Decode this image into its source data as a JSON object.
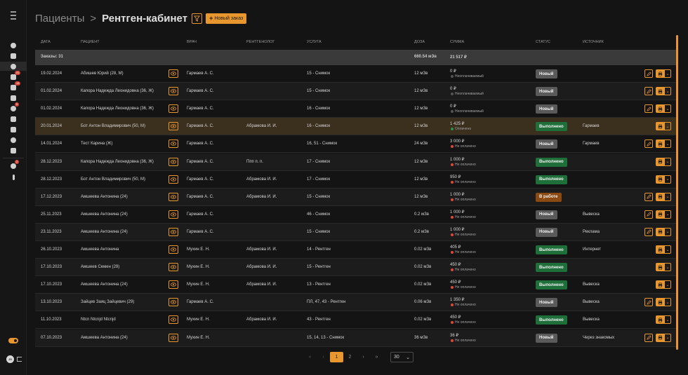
{
  "breadcrumb": {
    "root": "Пациенты",
    "separator": ">",
    "current": "Рентген-кабинет"
  },
  "toolbar": {
    "new_order_label": "Новый заказ"
  },
  "columns": {
    "date": "ДАТА",
    "patient": "ПАЦИЕНТ",
    "doctor": "ВРАЧ",
    "radiologist": "РЕНТГЕНОЛОГ",
    "service": "УСЛУГА",
    "dose": "ДОЗА",
    "sum": "СУММА",
    "status": "СТАТУС",
    "source": "ИСТОЧНИК"
  },
  "summary": {
    "orders": "Заказы: 31",
    "dose_total": "660.54 мЗв",
    "sum_total": "21 517 ₽"
  },
  "rows": [
    {
      "date": "19.02.2024",
      "patient": "Абишев Юрий (28, М)",
      "doctor": "Гармаев А. С.",
      "radiologist": "",
      "service": "15 - Снимок",
      "dose": "12 мЗв",
      "sum": "0 ₽",
      "pay": "Неоплачиваемый",
      "pay_state": "gray",
      "status": "Новый",
      "status_type": "new",
      "source": "",
      "editable": true,
      "highlight": false
    },
    {
      "date": "01.02.2024",
      "patient": "Капора Надежда Леонидовна (36, Ж)",
      "doctor": "Гармаев А. С.",
      "radiologist": "",
      "service": "15 - Снимок",
      "dose": "12 мЗв",
      "sum": "0 ₽",
      "pay": "Неоплачиваемый",
      "pay_state": "gray",
      "status": "Новый",
      "status_type": "new",
      "source": "",
      "editable": true,
      "highlight": false
    },
    {
      "date": "01.02.2024",
      "patient": "Капора Надежда Леонидовна (36, Ж)",
      "doctor": "Гармаев А. С.",
      "radiologist": "",
      "service": "16 - Снимок",
      "dose": "12 мЗв",
      "sum": "0 ₽",
      "pay": "Неоплачиваемый",
      "pay_state": "gray",
      "status": "Новый",
      "status_type": "new",
      "source": "",
      "editable": true,
      "highlight": false
    },
    {
      "date": "20.01.2024",
      "patient": "Бот Антон Владимирович (50, М)",
      "doctor": "Гармаев А. С.",
      "radiologist": "Абрамова И. И.",
      "service": "16 - Снимок",
      "dose": "12 мЗв",
      "sum": "1 425 ₽",
      "pay": "Оплачено",
      "pay_state": "green",
      "status": "Выполнено",
      "status_type": "done",
      "source": "Гармаев",
      "editable": false,
      "highlight": true
    },
    {
      "date": "14.01.2024",
      "patient": "Тест Карина (Ж)",
      "doctor": "Гармаев А. С.",
      "radiologist": "",
      "service": "16, 51 - Снимок",
      "dose": "24 мЗв",
      "sum": "3 000 ₽",
      "pay": "Не оплачено",
      "pay_state": "red",
      "status": "Новый",
      "status_type": "new",
      "source": "Гармаев",
      "editable": true,
      "highlight": false
    },
    {
      "date": "28.12.2023",
      "patient": "Капора Надежда Леонидовна (36, Ж)",
      "doctor": "Гармаев А. С.",
      "radiologist": "Ппп п. п.",
      "service": "17 - Снимок",
      "dose": "12 мЗв",
      "sum": "1 000 ₽",
      "pay": "Не оплачено",
      "pay_state": "red",
      "status": "Выполнено",
      "status_type": "done",
      "source": "",
      "editable": false,
      "highlight": false
    },
    {
      "date": "28.12.2023",
      "patient": "Бот Антон Владимирович (50, М)",
      "doctor": "Гармаев А. С.",
      "radiologist": "Абрамова И. И.",
      "service": "17 - Снимок",
      "dose": "12 мЗв",
      "sum": "950 ₽",
      "pay": "Не оплачено",
      "pay_state": "red",
      "status": "Выполнено",
      "status_type": "done",
      "source": "",
      "editable": false,
      "highlight": false
    },
    {
      "date": "17.12.2023",
      "patient": "Амшеева Антонина (24)",
      "doctor": "Гармаев А. С.",
      "radiologist": "Абрамова И. И.",
      "service": "15 - Снимок",
      "dose": "12 мЗв",
      "sum": "1 000 ₽",
      "pay": "Не оплачено",
      "pay_state": "red",
      "status": "В работе",
      "status_type": "work",
      "source": "",
      "editable": true,
      "highlight": false
    },
    {
      "date": "25.11.2023",
      "patient": "Амшеева Антонина (24)",
      "doctor": "Гармаев А. С.",
      "radiologist": "",
      "service": "46 - Снимок",
      "dose": "0.2 мЗв",
      "sum": "1 000 ₽",
      "pay": "Не оплачено",
      "pay_state": "red",
      "status": "Новый",
      "status_type": "new",
      "source": "Вывеска",
      "editable": true,
      "highlight": false
    },
    {
      "date": "23.11.2023",
      "patient": "Амшеева Антонина (24)",
      "doctor": "Гармаев А. С.",
      "radiologist": "",
      "service": "15 - Снимок",
      "dose": "0.2 мЗв",
      "sum": "1 000 ₽",
      "pay": "Не оплачено",
      "pay_state": "red",
      "status": "Новый",
      "status_type": "new",
      "source": "Реклама",
      "editable": true,
      "highlight": false
    },
    {
      "date": "26.10.2023",
      "patient": "Амшеева Антонина",
      "doctor": "Мухин Е. Н.",
      "radiologist": "Абрамова И. И.",
      "service": "14 - Рентген",
      "dose": "0.02 мЗв",
      "sum": "405 ₽",
      "pay": "Не оплачено",
      "pay_state": "red",
      "status": "Выполнено",
      "status_type": "done",
      "source": "Интернет",
      "editable": false,
      "highlight": false
    },
    {
      "date": "17.10.2023",
      "patient": "Амшеев Семен (29)",
      "doctor": "Мухин Е. Н.",
      "radiologist": "Абрамова И. И.",
      "service": "15 - Рентген",
      "dose": "0.02 мЗв",
      "sum": "450 ₽",
      "pay": "Не оплачено",
      "pay_state": "red",
      "status": "Выполнено",
      "status_type": "done",
      "source": "",
      "editable": false,
      "highlight": false
    },
    {
      "date": "17.10.2023",
      "patient": "Амшеева Антонина (24)",
      "doctor": "Мухин Е. Н.",
      "radiologist": "Абрамова И. И.",
      "service": "13 - Рентген",
      "dose": "0.02 мЗв",
      "sum": "450 ₽",
      "pay": "Не оплачено",
      "pay_state": "red",
      "status": "Выполнено",
      "status_type": "done",
      "source": "Вывеска",
      "editable": false,
      "highlight": false
    },
    {
      "date": "13.10.2023",
      "patient": "Зайцев Заяц Зайцевич (29)",
      "doctor": "Гармаев А. С.",
      "radiologist": "",
      "service": "ПЛ, 47, 43 - Рентген",
      "dose": "0.06 мЗв",
      "sum": "1 350 ₽",
      "pay": "Не оплачено",
      "pay_state": "red",
      "status": "Новый",
      "status_type": "new",
      "source": "Вывеска",
      "editable": true,
      "highlight": false
    },
    {
      "date": "11.10.2023",
      "patient": "Ntcn Ntcnjd Ntcnjd",
      "doctor": "Мухин Е. Н.",
      "radiologist": "Абрамова И. И.",
      "service": "43 - Рентген",
      "dose": "0.02 мЗв",
      "sum": "450 ₽",
      "pay": "Не оплачено",
      "pay_state": "red",
      "status": "Выполнено",
      "status_type": "done",
      "source": "Вывеска",
      "editable": false,
      "highlight": false
    },
    {
      "date": "07.10.2023",
      "patient": "Амшеева Антонина (24)",
      "doctor": "Мухин Е. Н.",
      "radiologist": "",
      "service": "15, 14, 13 - Снимок",
      "dose": "36 мЗв",
      "sum": "36 ₽",
      "pay": "Не оплачено",
      "pay_state": "red",
      "status": "Новый",
      "status_type": "new",
      "source": "Через знакомых",
      "editable": true,
      "highlight": false
    }
  ],
  "pagination": {
    "first": "«",
    "prev": "‹",
    "pages": [
      "1",
      "2"
    ],
    "active": "1",
    "next": "›",
    "last": "»",
    "page_size": "30"
  },
  "sidebar_badges": {
    "b1": "41",
    "b2": "15",
    "b3": "5",
    "b4": "2"
  },
  "avatar_initials": "JS",
  "colors": {
    "accent": "#e8962e",
    "done": "#1f6f3a",
    "new": "#5a5a5a",
    "work": "#8a4a12",
    "highlight_row": "#3b2f1e"
  },
  "icons": [
    "menu-icon",
    "clock-icon",
    "card-icon",
    "users-icon",
    "calendar-icon",
    "list-icon",
    "basket-icon",
    "box-icon",
    "book-icon",
    "chart-icon",
    "gear-icon",
    "puzzle-icon",
    "bell-icon",
    "info-icon",
    "eye-icon",
    "edit-icon",
    "print-icon",
    "filter-icon"
  ]
}
